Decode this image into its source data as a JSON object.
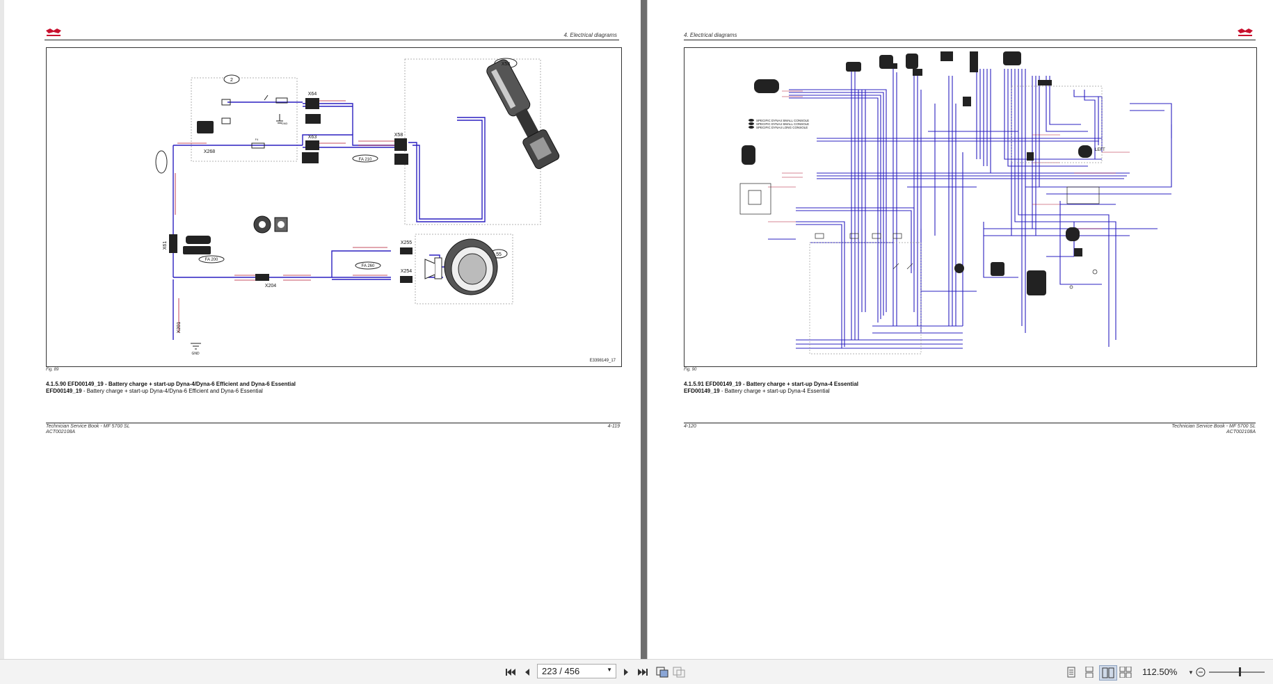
{
  "left_page": {
    "header": "4. Electrical diagrams",
    "figure_label": "Fig. 89",
    "diagram_code": "E3398149_17",
    "caption_title": "4.1.5.90   EFD00149_19 - Battery charge + start-up Dyna-4/Dyna-6 Efficient and Dyna-6 Essential",
    "caption_code": "EFD00149_19",
    "caption_text": " - Battery charge + start-up Dyna-4/Dyna-6 Efficient and Dyna-6 Essential",
    "footer_book": "Technician Service Book - MF 5700 SL",
    "footer_ref": "ACT002108A",
    "page_number": "4-119",
    "diagram_labels": {
      "box2": "2",
      "x64": "X64",
      "x63": "X63",
      "x58_conn": "X58",
      "x58": "X58",
      "x268": "X268",
      "x61": "X61",
      "x204": "X204",
      "x255": "X255",
      "x254": "X254",
      "x201": "X201",
      "box55": "55",
      "f4": "F4",
      "fa210": "FA 210",
      "fa200": "FA 200",
      "fa260": "FA 260",
      "gnd": "GND"
    }
  },
  "right_page": {
    "header": "4. Electrical diagrams",
    "figure_label": "Fig. 90",
    "caption_title": "4.1.5.91   EFD00149_19 - Battery charge + start-up Dyna-4 Essential",
    "caption_code": "EFD00149_19",
    "caption_text": " - Battery charge + start-up Dyna-4 Essential",
    "footer_book": "Technician Service Book - MF 5700 SL",
    "footer_ref": "ACT002108A",
    "page_number": "4-120",
    "diagram_labels": {
      "left": "LEFT",
      "console1": "SPECIFIC DYNA4 SMALL CONSOLE",
      "console2": "SPECIFIC DYNA4 SMALL CONSOLE",
      "console3": "SPECIFIC DYNA4 LONG CONSOLE"
    }
  },
  "toolbar": {
    "page_value": "223 / 456",
    "zoom": "112.50%"
  },
  "colors": {
    "wire_blue": "#2a1fc0",
    "wire_red": "#b0102a",
    "logo_red": "#c8102e",
    "gutter": "#6e6e6e"
  },
  "icons": [
    "first-page-icon",
    "prev-page-icon",
    "next-page-icon",
    "last-page-icon",
    "fit-width-icon",
    "fit-page-icon",
    "single-page-icon",
    "continuous-icon",
    "two-page-icon",
    "two-page-continuous-icon",
    "zoom-out-icon"
  ]
}
